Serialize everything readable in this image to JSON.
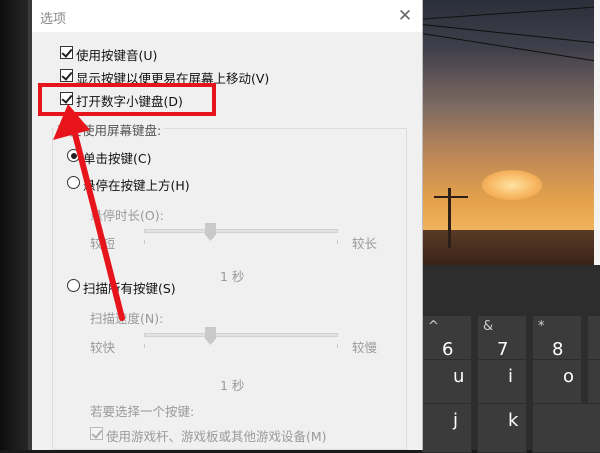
{
  "dialog": {
    "title": "选项",
    "close_glyph": "✕",
    "options": [
      {
        "label": "使用按键音(U)",
        "checked": true
      },
      {
        "label": "显示按键以便更易在屏幕上移动(V)",
        "checked": true
      },
      {
        "label": "打开数字小键盘(D)",
        "checked": true
      }
    ],
    "group": {
      "title": "若要使用屏幕键盘:",
      "mode_click": {
        "label": "单击按键(C)",
        "selected": true
      },
      "mode_hover": {
        "label": "悬停在按键上方(H)",
        "selected": false
      },
      "hover_duration": {
        "label": "悬停时长(O):",
        "min_label": "较短",
        "max_label": "较长",
        "value_text": "1 秒"
      },
      "mode_scan": {
        "label": "扫描所有按键(S)",
        "selected": false
      },
      "scan_speed": {
        "label": "扫描速度(N):",
        "min_label": "较快",
        "max_label": "较慢",
        "value_text": "1 秒"
      },
      "select_key_label": "若要选择一个按键:",
      "use_gamepad": {
        "label": "使用游戏杆、游戏板或其他游戏设备(M)",
        "checked": true,
        "enabled": false
      }
    }
  },
  "keyboard": {
    "row1": [
      {
        "sub": "^",
        "main": "6"
      },
      {
        "sub": "&",
        "main": "7"
      },
      {
        "sub": "*",
        "main": "8"
      }
    ],
    "row2": [
      "u",
      "i",
      "o"
    ],
    "row3": [
      "j",
      "k"
    ]
  },
  "annotation": {
    "color": "#e8141c"
  }
}
